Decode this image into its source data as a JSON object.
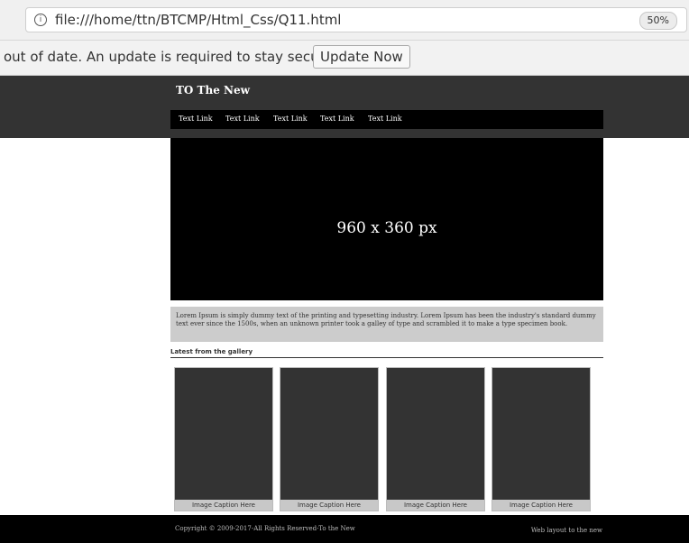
{
  "browser": {
    "url": "file:///home/ttn/BTCMP/Html_Css/Q11.html",
    "zoom": "50%",
    "info_icon": "i"
  },
  "update_bar": {
    "message": "out of date. An update is required to stay secure.",
    "button_label": "Update Now"
  },
  "header": {
    "brand": "TO The New",
    "nav": [
      "Text Link",
      "Text Link",
      "Text Link",
      "Text Link",
      "Text Link"
    ]
  },
  "banner": {
    "label": "960 x 360 px"
  },
  "intro": {
    "text": "Lorem Ipsum is simply dummy text of the printing and typesetting industry. Lorem Ipsum has been the industry's standard dummy text ever since the 1500s, when an unknown printer took a galley of type and scrambled it to make a type specimen book."
  },
  "gallery": {
    "title": "Latest from the gallery",
    "captions": [
      "Image Caption Here",
      "Image Caption Here",
      "Image Caption Here",
      "Image Caption Here"
    ]
  },
  "footer": {
    "copyright": "Copyright © 2009-2017-All Rights Reserved-To the New",
    "credit": "Web layout to the new"
  }
}
